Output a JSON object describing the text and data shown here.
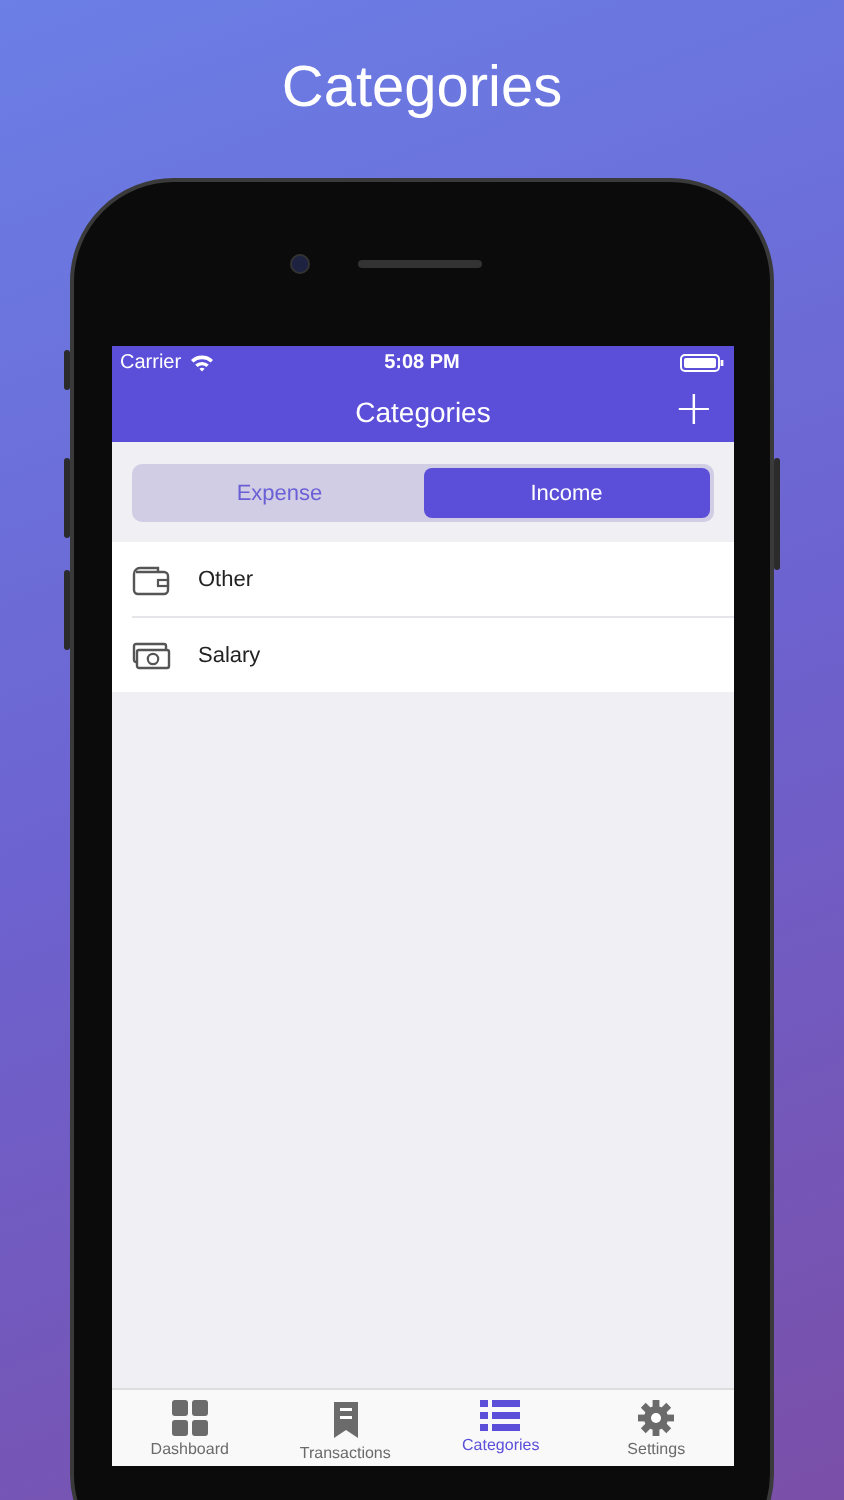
{
  "headline": "Categories",
  "status_bar": {
    "carrier": "Carrier",
    "time": "5:08 PM"
  },
  "nav_bar": {
    "title": "Categories",
    "add_button": "+"
  },
  "segments": [
    {
      "label": "Expense",
      "selected": false
    },
    {
      "label": "Income",
      "selected": true
    }
  ],
  "categories": [
    {
      "name": "Other",
      "kind": "wallet"
    },
    {
      "name": "Salary",
      "kind": "cash"
    }
  ],
  "tab_bar": [
    {
      "label": "Dashboard",
      "kind": "grid",
      "selected": false
    },
    {
      "label": "Transactions",
      "kind": "receipt",
      "selected": false
    },
    {
      "label": "Categories",
      "kind": "list",
      "selected": true
    },
    {
      "label": "Settings",
      "kind": "gear",
      "selected": false
    }
  ]
}
